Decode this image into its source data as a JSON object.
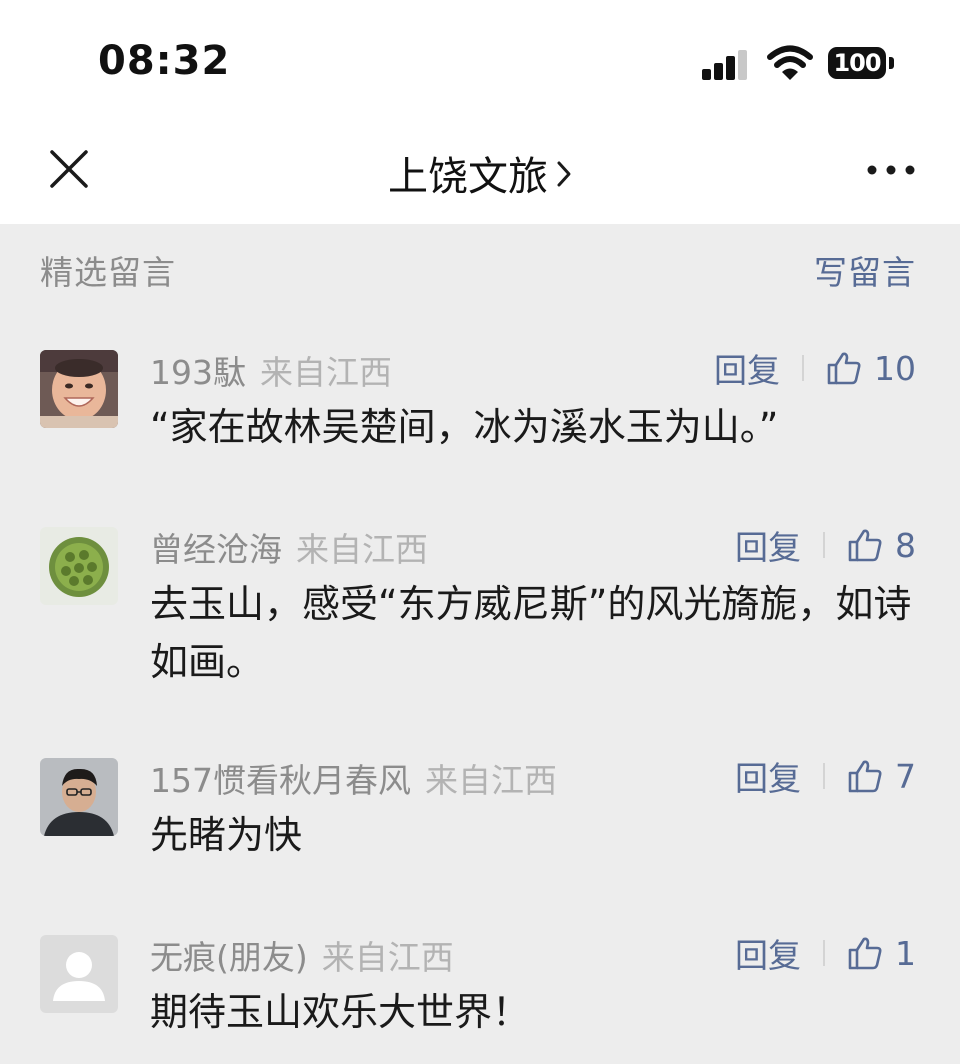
{
  "status_bar": {
    "time": "08:32",
    "battery": "100"
  },
  "nav": {
    "title": "上饶文旅",
    "chevron": "›"
  },
  "comments_section": {
    "title": "精选留言",
    "write_label": "写留言"
  },
  "comments": [
    {
      "author": "193駄",
      "from": "来自江西",
      "reply_label": "回复",
      "likes": "10",
      "text": "“家在故林吴楚间，冰为溪水玉为山。”",
      "avatar": "child-photo-avatar"
    },
    {
      "author": "曾经沧海",
      "from": "来自江西",
      "reply_label": "回复",
      "likes": "8",
      "text": "去玉山，感受“东方威尼斯”的风光旖旎，如诗如画。",
      "avatar": "lotus-pod-avatar"
    },
    {
      "author": "157惯看秋月春风",
      "from": "来自江西",
      "reply_label": "回复",
      "likes": "7",
      "text": "先睹为快",
      "avatar": "man-portrait-avatar"
    },
    {
      "author": "无痕(朋友)",
      "from": "来自江西",
      "reply_label": "回复",
      "likes": "1",
      "text": "期待玉山欢乐大世界！",
      "avatar": "default-user-avatar"
    }
  ],
  "icons": {
    "close": "close-icon",
    "more": "more-icon",
    "like": "thumbs-up-icon",
    "signal": "signal-icon",
    "wifi": "wifi-icon",
    "battery": "battery-icon"
  },
  "colors": {
    "link_blue": "#576b95",
    "background": "#ededed",
    "secondary_text": "#8c8c8c"
  }
}
